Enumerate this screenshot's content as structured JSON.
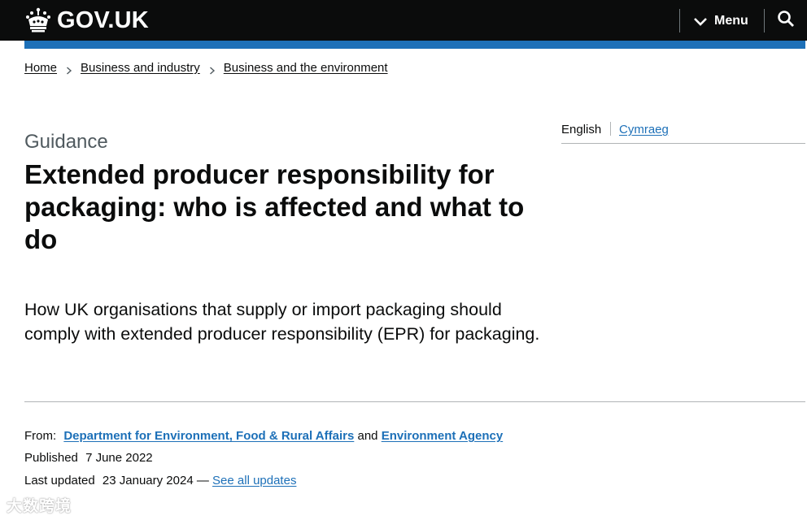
{
  "header": {
    "logo_text": "GOV.UK",
    "menu_label": "Menu",
    "icons": [
      "crown-icon",
      "chevron-down-icon",
      "search-icon"
    ]
  },
  "breadcrumb": {
    "items": [
      "Home",
      "Business and industry",
      "Business and the environment"
    ]
  },
  "language": {
    "current": "English",
    "alternate": "Cymraeg"
  },
  "page": {
    "caption": "Guidance",
    "title": "Extended producer responsibility for packaging: who is affected and what to do",
    "lead": "How UK organisations that supply or import packaging should comply with extended producer responsibility (EPR) for packaging."
  },
  "metadata": {
    "from_label": "From:",
    "org1": "Department for Environment, Food & Rural Affairs",
    "and_text": "and",
    "org2": "Environment Agency",
    "published_label": "Published",
    "published_date": "7 June 2022",
    "updated_label": "Last updated",
    "updated_date": "23 January 2024",
    "dash": "—",
    "see_updates": "See all updates"
  },
  "watermark": "大数跨境",
  "colors": {
    "header_bg": "#0b0c0c",
    "accent_blue": "#1d70b8",
    "text": "#0b0c0c",
    "secondary_text": "#505a5f",
    "border": "#b1b4b6"
  }
}
